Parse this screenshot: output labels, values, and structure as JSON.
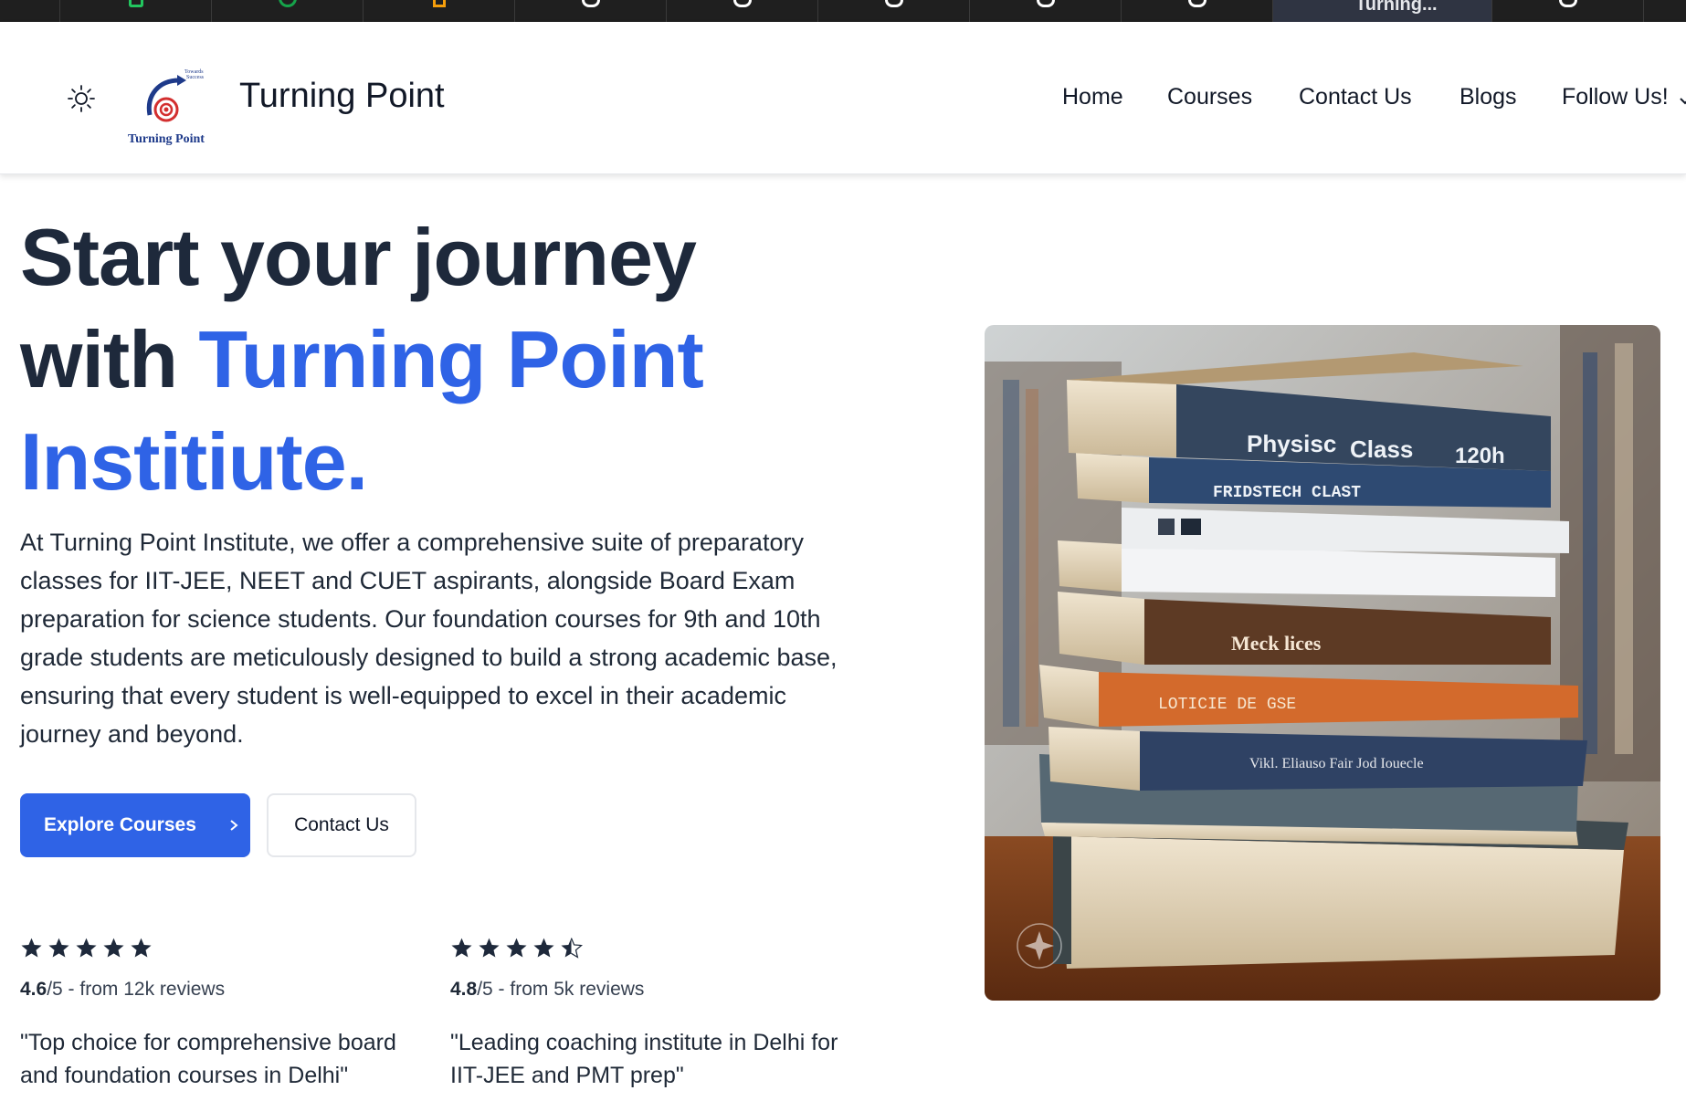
{
  "browser": {
    "active_tab_title": "Turning..."
  },
  "header": {
    "brand_name": "Turning Point",
    "logo_text": "Turning Point",
    "logo_tagline": "Towards Success",
    "nav": [
      "Home",
      "Courses",
      "Contact Us",
      "Blogs",
      "Follow Us!"
    ]
  },
  "hero": {
    "title_line1": "Start your journey",
    "title_line2_prefix": "with ",
    "title_line2_highlight": "Turning Point",
    "title_line3": "Institiute.",
    "description": "At Turning Point Institute, we offer a comprehensive suite of preparatory classes for IIT-JEE, NEET and CUET aspirants, alongside Board Exam preparation for science students. Our foundation courses for 9th and 10th grade students are meticulously designed to build a strong academic base, ensuring that every student is well-equipped to excel in their academic journey and beyond.",
    "primary_button": "Explore Courses",
    "secondary_button": "Contact Us"
  },
  "reviews": [
    {
      "rating": "4.6",
      "scale": "/5",
      "source": " - from 12k reviews",
      "stars": 5,
      "quote": "\"Top choice for comprehensive board and foundation courses in Delhi\""
    },
    {
      "rating": "4.8",
      "scale": "/5",
      "source": " - from 5k reviews",
      "stars": 4.5,
      "quote": "\"Leading coaching institute in Delhi for IIT-JEE and PMT prep\""
    }
  ],
  "image_book_labels": [
    "Physisc",
    "Class",
    "120h",
    "FRIDSTECH CLAST",
    "Meck lices"
  ],
  "colors": {
    "accent": "#2f63e6",
    "heading": "#1e293b",
    "text": "#1f2937",
    "tabstrip": "#1f1f1f"
  }
}
